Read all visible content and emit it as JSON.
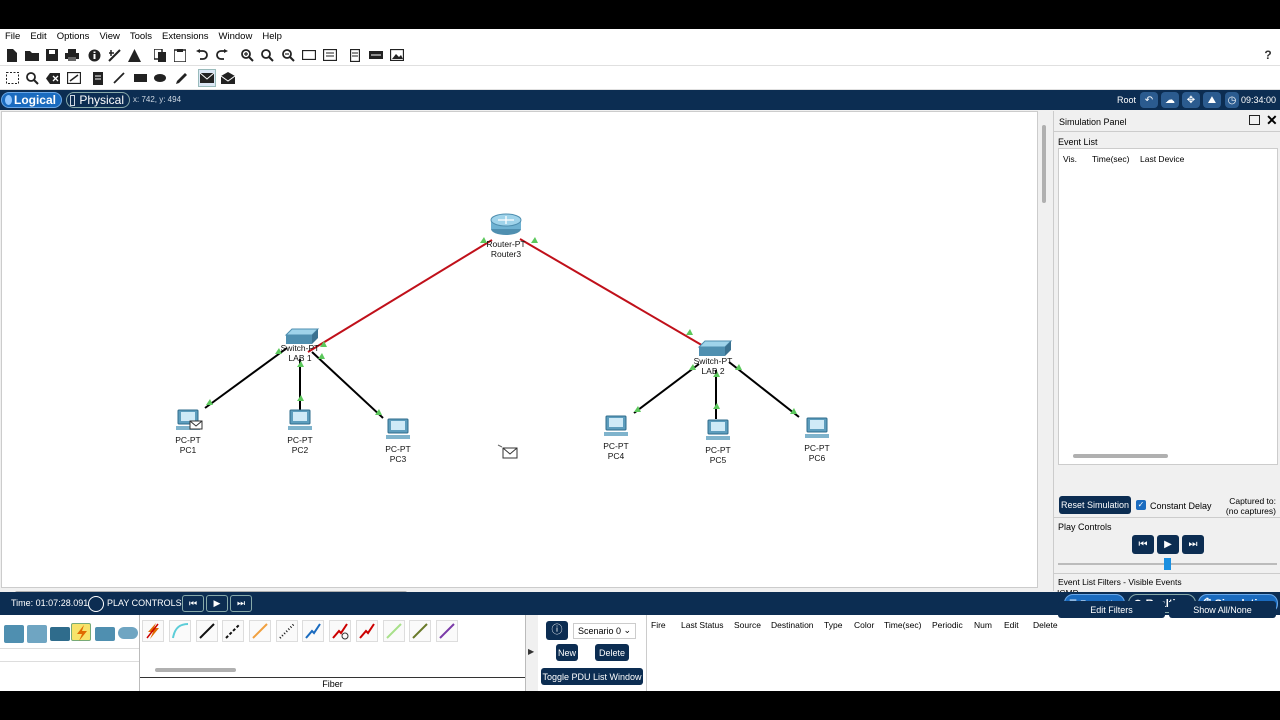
{
  "menu": [
    "File",
    "Edit",
    "Options",
    "View",
    "Tools",
    "Extensions",
    "Window",
    "Help"
  ],
  "help_glyph": "?",
  "view": {
    "logical": "Logical",
    "physical": "Physical",
    "coords": "x: 742, y: 494",
    "root": "Root",
    "clock": "09:34:00"
  },
  "devices": [
    {
      "model": "Router-PT",
      "name": "Router3"
    },
    {
      "model": "Switch-PT",
      "name": "LAB 1"
    },
    {
      "model": "Switch-PT",
      "name": "LAB 2"
    },
    {
      "model": "PC-PT",
      "name": "PC1"
    },
    {
      "model": "PC-PT",
      "name": "PC2"
    },
    {
      "model": "PC-PT",
      "name": "PC3"
    },
    {
      "model": "PC-PT",
      "name": "PC4"
    },
    {
      "model": "PC-PT",
      "name": "PC5"
    },
    {
      "model": "PC-PT",
      "name": "PC6"
    }
  ],
  "colors": {
    "router_link": "#c0101a",
    "access_link": "#000000",
    "port_up": "#5cc85c",
    "accent_dark": "#0c2d52"
  },
  "sim_panel": {
    "title": "Simulation Panel",
    "event_list_label": "Event List",
    "columns": [
      "Vis.",
      "Time(sec)",
      "Last Device"
    ],
    "reset_button": "Reset Simulation",
    "constant_delay": "Constant Delay",
    "constant_delay_checked": true,
    "captured_line1": "Captured to:",
    "captured_line2": "(no captures)",
    "play_controls": "Play Controls",
    "filters_label": "Event List Filters - Visible Events",
    "filters_value": "ICMP",
    "edit_filters": "Edit Filters",
    "show_all": "Show All/None"
  },
  "bottom_bar": {
    "time": "Time: 01:07:28.091",
    "play_controls": "PLAY CONTROLS:",
    "event_list": "Event List",
    "realtime": "Realtime",
    "simulation": "Simulation"
  },
  "device_panel": {
    "current_cable": "Fiber"
  },
  "pdu": {
    "scenario": "Scenario 0",
    "new": "New",
    "delete": "Delete",
    "toggle": "Toggle PDU List Window",
    "columns": [
      "Fire",
      "Last Status",
      "Source",
      "Destination",
      "Type",
      "Color",
      "Time(sec)",
      "Periodic",
      "Num",
      "Edit",
      "Delete"
    ]
  }
}
